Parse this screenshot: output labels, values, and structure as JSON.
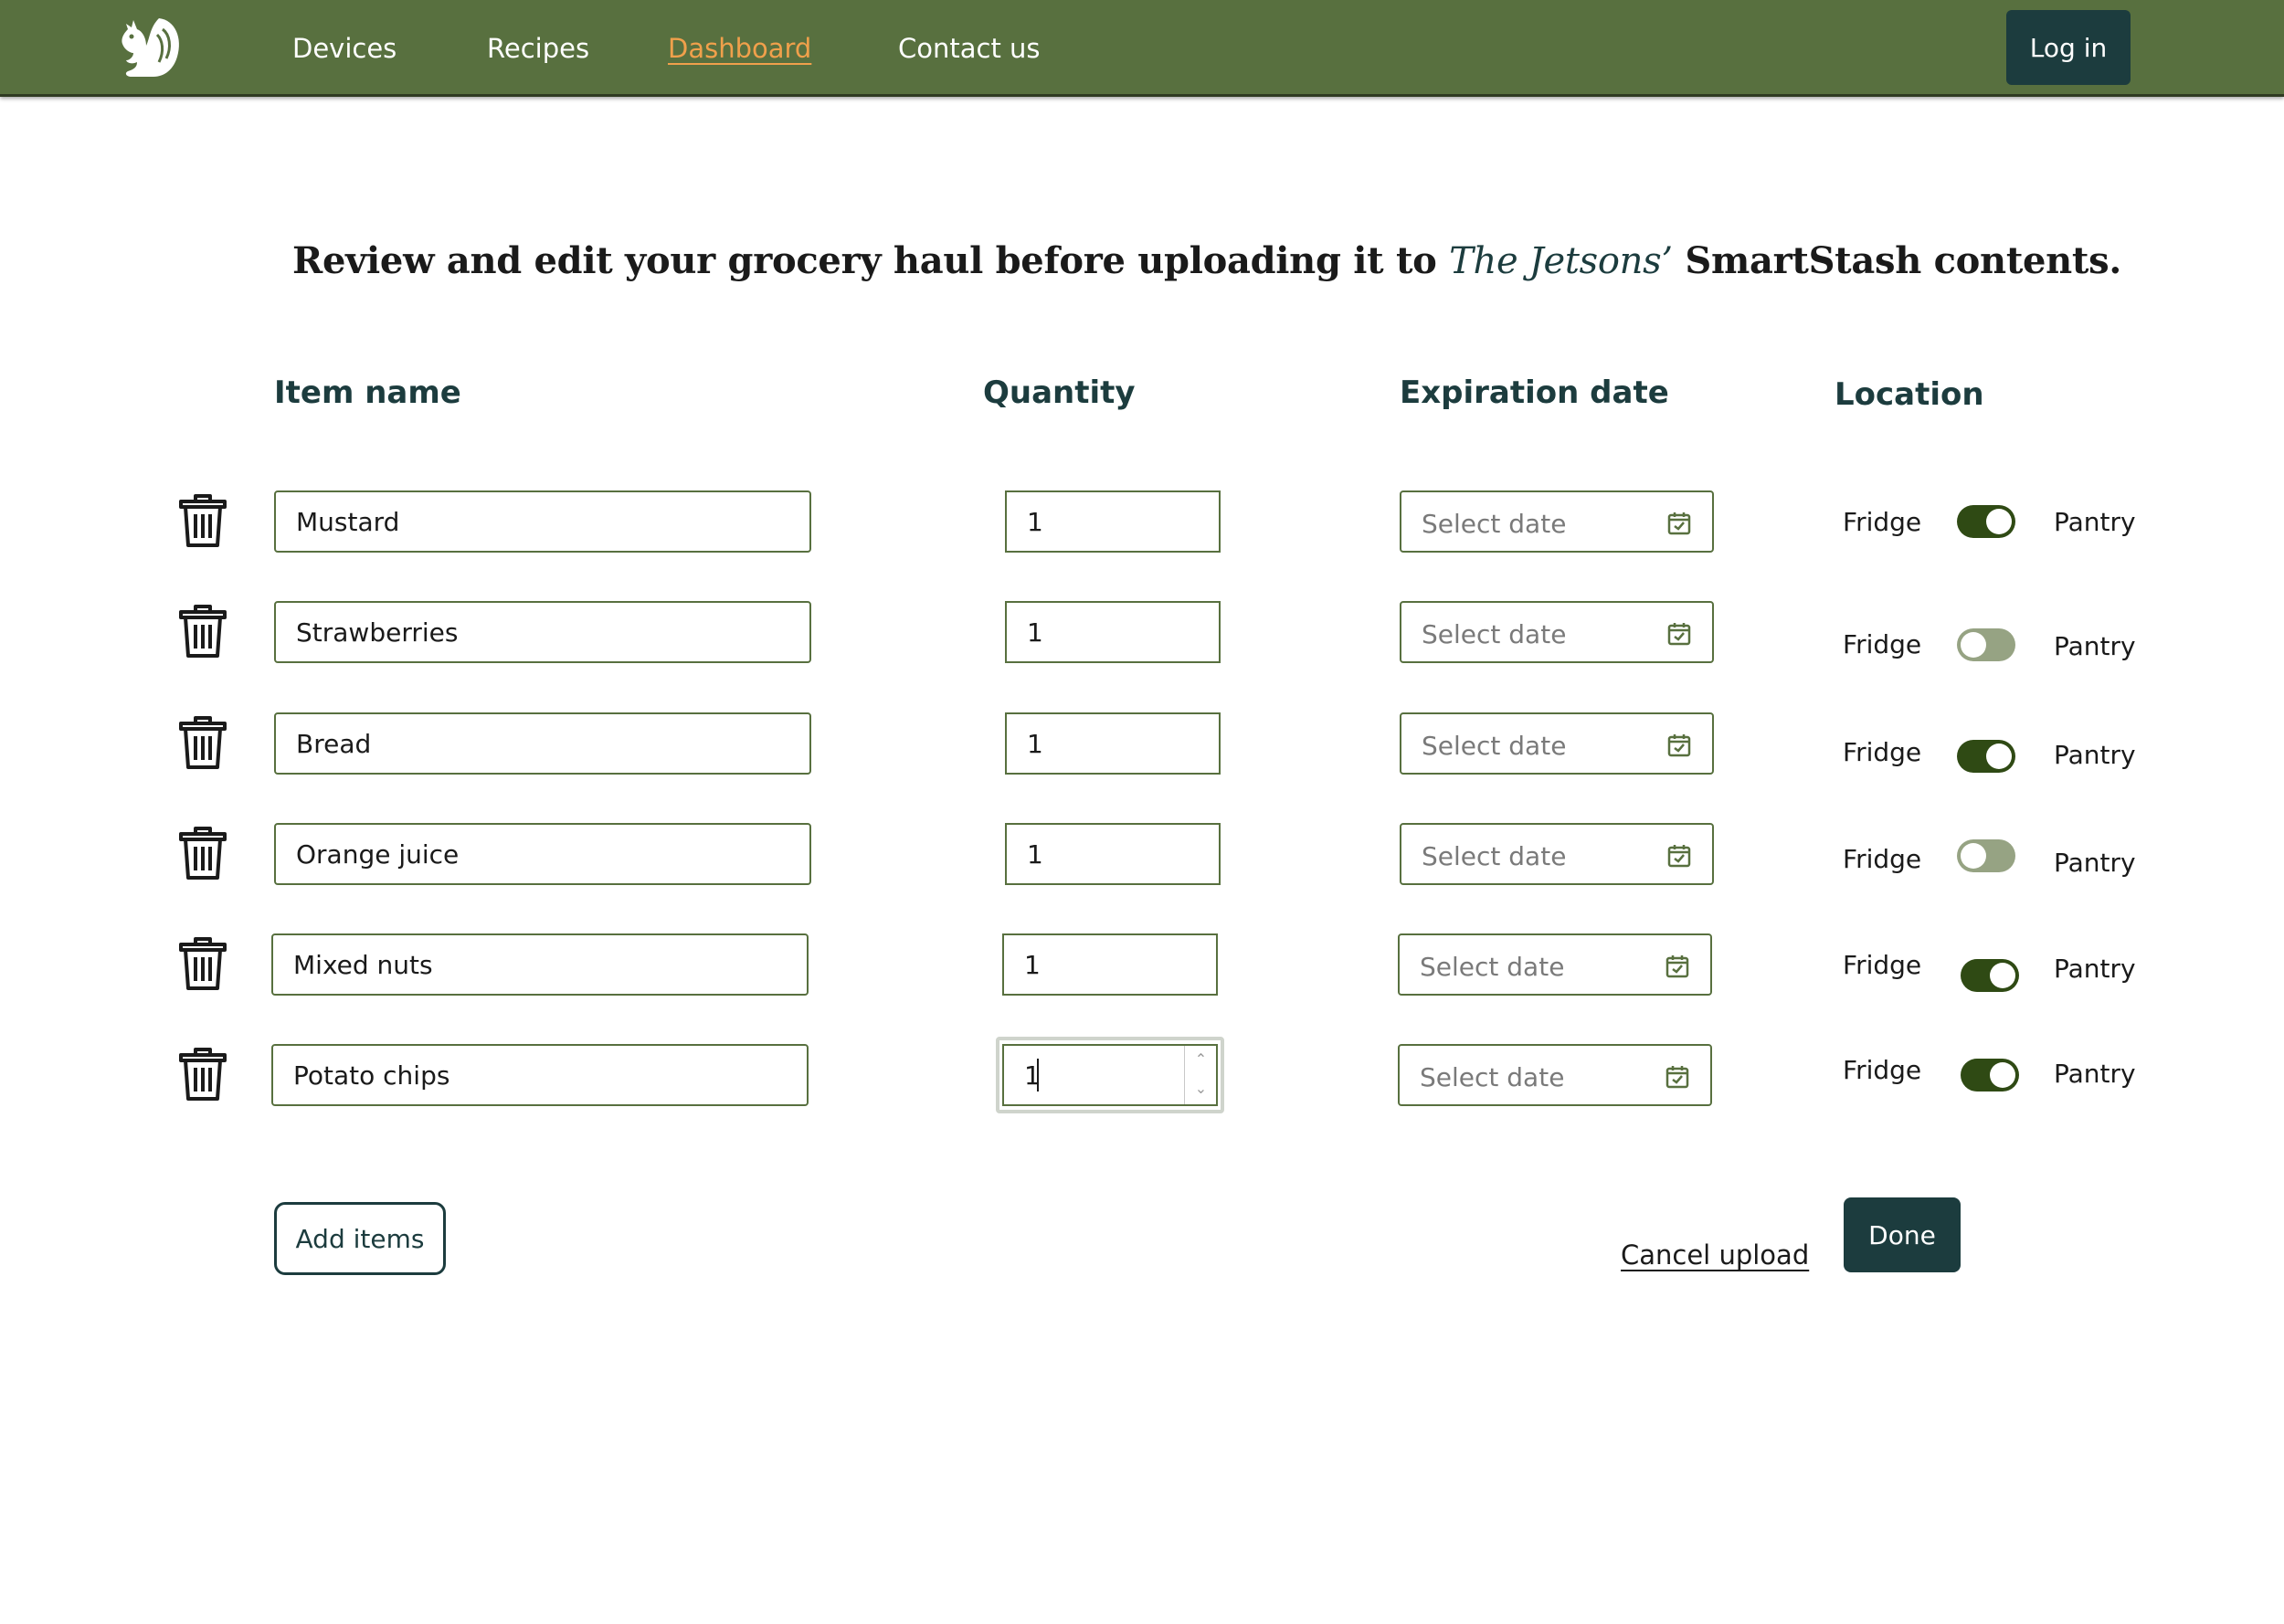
{
  "nav": {
    "logo_icon": "squirrel-icon",
    "links": [
      "Devices",
      "Recipes",
      "Dashboard",
      "Contact us"
    ],
    "active_link": "Dashboard",
    "login_label": "Log in"
  },
  "heading": {
    "before": "Review and edit your grocery haul before uploading it to ",
    "owner": "The Jetsons’",
    "after": " SmartStash contents."
  },
  "columns": {
    "item_name": "Item name",
    "quantity": "Quantity",
    "expiration": "Expiration date",
    "location": "Location"
  },
  "items": [
    {
      "name": "Mustard",
      "quantity": "1",
      "date_placeholder": "Select date",
      "left_label": "Fridge",
      "right_label": "Pantry",
      "toggle": "on"
    },
    {
      "name": "Strawberries",
      "quantity": "1",
      "date_placeholder": "Select date",
      "left_label": "Fridge",
      "right_label": "Pantry",
      "toggle": "off"
    },
    {
      "name": "Bread",
      "quantity": "1",
      "date_placeholder": "Select date",
      "left_label": "Fridge",
      "right_label": "Pantry",
      "toggle": "on"
    },
    {
      "name": "Orange juice",
      "quantity": "1",
      "date_placeholder": "Select date",
      "left_label": "Fridge",
      "right_label": "Pantry",
      "toggle": "off"
    },
    {
      "name": "Mixed nuts",
      "quantity": "1",
      "date_placeholder": "Select date",
      "left_label": "Fridge",
      "right_label": "Pantry",
      "toggle": "on"
    },
    {
      "name": "Potato chips",
      "quantity": "1",
      "date_placeholder": "Select date",
      "left_label": "Fridge",
      "right_label": "Pantry",
      "toggle": "on"
    }
  ],
  "actions": {
    "add_label": "Add items",
    "cancel_label": "Cancel upload",
    "done_label": "Done"
  },
  "colors": {
    "navbar": "#58703f",
    "accent": "#1c3c3e",
    "active_link": "#f0a04b",
    "toggle_on": "#2f4a14",
    "toggle_off": "#96a383"
  }
}
